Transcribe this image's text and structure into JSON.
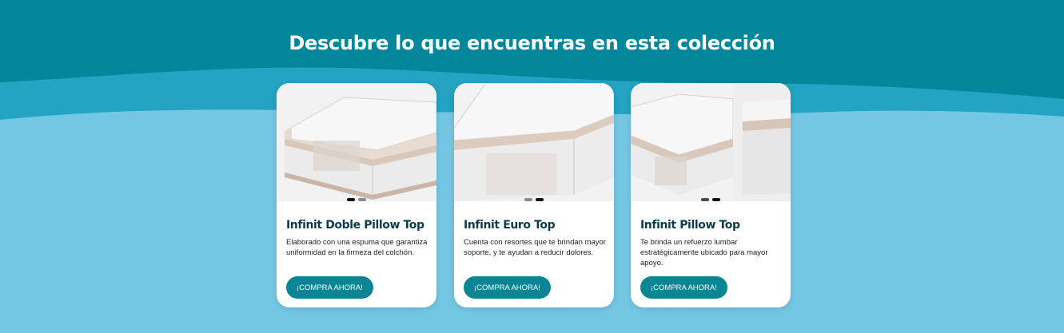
{
  "section": {
    "title": "Descubre lo que encuentras en esta colección"
  },
  "colors": {
    "header_bg": "#04879a",
    "wave_mid": "#24a3c2",
    "wave_light": "#74c7e3",
    "card_bg": "#ffffff",
    "button_bg": "#0a8596",
    "title_text": "#0e3b4a"
  },
  "products": [
    {
      "name": "Infinit Doble Pillow Top",
      "description": "Elaborado con una espuma que garantiza uniformidad en la firmeza del colchón.",
      "button_label": "¡COMPRA AHORA!",
      "image_alt": "mattress-image",
      "carousel": {
        "slides": 2,
        "active_index": 0
      }
    },
    {
      "name": "Infinit Euro Top",
      "description": "Cuenta con resortes que te brindan mayor soporte, y te ayudan a reducir dolores.",
      "button_label": "¡COMPRA AHORA!",
      "image_alt": "mattress-image",
      "carousel": {
        "slides": 2,
        "active_index": 1
      }
    },
    {
      "name": "Infinit Pillow Top",
      "description": "Te brinda un refuerzo lumbar estratégicamente ubicado para mayor apoyo.",
      "button_label": "¡COMPRA AHORA!",
      "image_alt": "mattress-image",
      "carousel": {
        "slides": 2,
        "active_index": 1
      }
    }
  ]
}
